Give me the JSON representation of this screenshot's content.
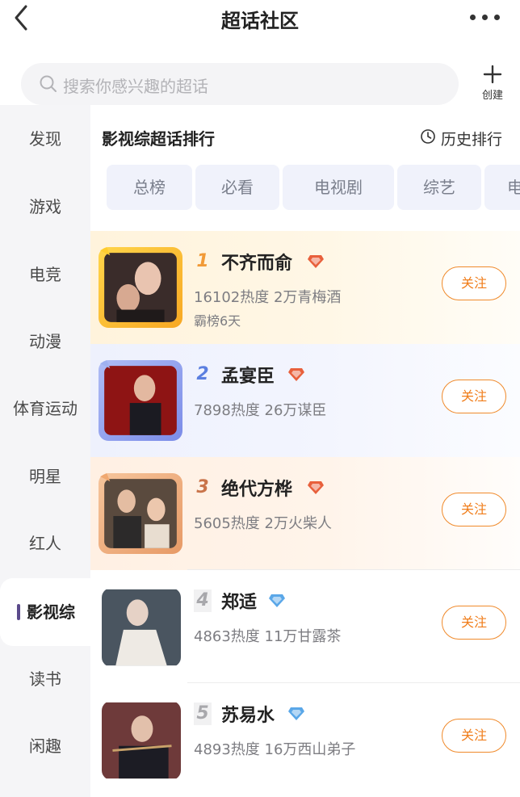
{
  "header": {
    "title": "超话社区",
    "back_icon": "chevron-left-icon",
    "more_icon": "more-dots-icon"
  },
  "search": {
    "placeholder": "搜索你感兴趣的超话",
    "icon": "search-icon"
  },
  "create": {
    "label": "创建",
    "icon": "plus-icon"
  },
  "sidebar": {
    "items": [
      {
        "label": "发现"
      },
      {
        "label": "游戏"
      },
      {
        "label": "电竞"
      },
      {
        "label": "动漫"
      },
      {
        "label": "体育运动"
      },
      {
        "label": "明星"
      },
      {
        "label": "红人"
      },
      {
        "label": "影视综",
        "active": true
      },
      {
        "label": "读书"
      },
      {
        "label": "闲趣"
      }
    ]
  },
  "main": {
    "section_title": "影视综超话排行",
    "history_label": "历史排行",
    "history_icon": "clock-icon",
    "tabs": [
      {
        "label": "总榜"
      },
      {
        "label": "必看"
      },
      {
        "label": "电视剧"
      },
      {
        "label": "综艺"
      },
      {
        "label": "电"
      }
    ],
    "items": [
      {
        "rank": "1",
        "name": "不齐而俞",
        "stats": "16102热度 2万青梅酒",
        "extra": "霸榜6天",
        "follow": "关注",
        "badge_color": "#e8603c",
        "rank_color": "#f19a37"
      },
      {
        "rank": "2",
        "name": "孟宴臣",
        "stats": "7898热度 26万谋臣",
        "follow": "关注",
        "badge_color": "#e8603c",
        "rank_color": "#5b7fe0"
      },
      {
        "rank": "3",
        "name": "绝代方桦",
        "stats": "5605热度 2万火柴人",
        "follow": "关注",
        "badge_color": "#e8603c",
        "rank_color": "#c9744a"
      },
      {
        "rank": "4",
        "name": "郑适",
        "stats": "4863热度 11万甘露茶",
        "follow": "关注",
        "badge_color": "#5aa7e8",
        "rank_color": "#a8a8ac"
      },
      {
        "rank": "5",
        "name": "苏易水",
        "stats": "4893热度 16万西山弟子",
        "follow": "关注",
        "badge_color": "#5aa7e8",
        "rank_color": "#a8a8ac"
      }
    ]
  },
  "colors": {
    "accent": "#f07d1a",
    "sidebar_bg": "#f5f5f7",
    "tab_bg": "#f0f2fb"
  }
}
